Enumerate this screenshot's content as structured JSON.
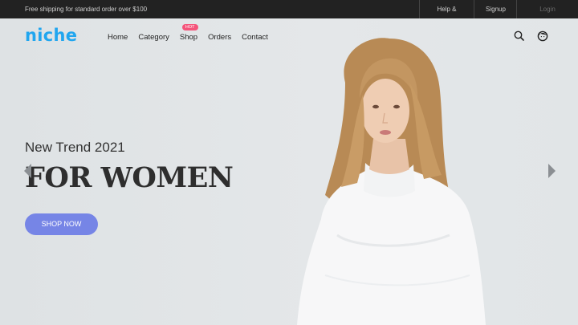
{
  "topbar": {
    "promo": "Free shipping for standard order over $100",
    "help": "Help & FAQs",
    "signup": "Signup",
    "login": "Login"
  },
  "header": {
    "logo": "niche",
    "nav": [
      {
        "label": "Home"
      },
      {
        "label": "Category"
      },
      {
        "label": "Shop",
        "badge": "HOT"
      },
      {
        "label": "Orders"
      },
      {
        "label": "Contact"
      }
    ],
    "icons": [
      "search-icon",
      "user-icon"
    ]
  },
  "hero": {
    "subtitle": "New Trend 2021",
    "headline": "FOR WOMEN",
    "cta": "SHOP NOW"
  },
  "colors": {
    "logo": "#21a6ef",
    "cta": "#7685e6",
    "badge": "#f4547a",
    "topbar": "#222222"
  }
}
